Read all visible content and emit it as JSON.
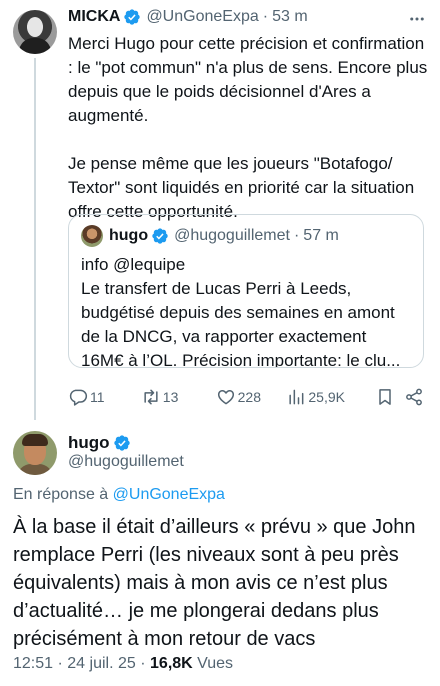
{
  "reply_tweet": {
    "name": "MICKA",
    "handle": "@UnGoneExpa",
    "time": "53 m",
    "separator": "·",
    "paragraph1": "Merci Hugo pour cette précision et confirmation : le \"pot commun\" n'a plus de sens. Encore plus depuis que le poids décisionnel d'Ares a augmenté.",
    "paragraph2": "Je pense même que les joueurs \"Botafogo/ Textor\" sont liquidés en priorité car la situation offre cette opportunité.",
    "quoted": {
      "name": "hugo",
      "handle": "@hugoguillemet",
      "time": "57 m",
      "separator": "·",
      "lines": [
        "info @lequipe",
        "Le transfert de Lucas Perri à Leeds,",
        "budgétisé depuis des semaines en amont",
        "de la DNCG, va rapporter exactement",
        "16M€ à l’OL. Précision importante: le clu..."
      ]
    },
    "actions": {
      "reply_count": "11",
      "retweet_count": "13",
      "like_count": "228",
      "view_count": "25,9K"
    }
  },
  "main_tweet": {
    "name": "hugo",
    "handle": "@hugoguillemet",
    "replying_prefix": "En réponse à",
    "replying_to": "@UnGoneExpa",
    "text": "À la base il était d’ailleurs « prévu » que John remplace Perri (les niveaux sont à peu près équivalents) mais à mon avis ce n’est plus d’actualité… je me plongerai dedans plus précisément à mon retour de vacs",
    "time": "12:51",
    "date": "24 juil. 25",
    "separator": "·",
    "views_count": "16,8K",
    "views_label": "Vues"
  },
  "colors": {
    "verified": "#1d9bf0",
    "link": "#1d9bf0",
    "secondary_text": "#536471",
    "primary_text": "#0f1419",
    "border": "#cfd9de"
  },
  "icons": {
    "verified": "verified-badge-icon",
    "more": "more-options-icon",
    "reply": "reply-icon",
    "retweet": "retweet-icon",
    "like": "heart-icon",
    "views": "views-chart-icon",
    "bookmark": "bookmark-icon",
    "share": "share-icon"
  }
}
